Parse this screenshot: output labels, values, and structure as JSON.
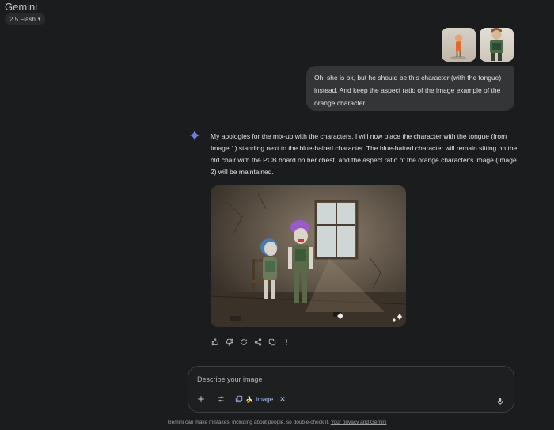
{
  "header": {
    "app_title": "Gemini",
    "model_label": "2.5 Flash"
  },
  "user_message": {
    "attachments": [
      "character-thumbnail-1",
      "character-thumbnail-2"
    ],
    "text": "Oh, she is ok, but he should be this character (with the tongue) instead. And keep the aspect ratio of the image example of the orange character"
  },
  "response": {
    "text": "My apologies for the mix-up with the characters. I will now place the character with the tongue (from Image 1) standing next to the blue-haired character. The blue-haired character will remain sitting on the old chair with the PCB board on her chest, and the aspect ratio of the orange character's image (Image 2) will be maintained.",
    "actions": [
      "thumbs-up-icon",
      "thumbs-down-icon",
      "regenerate-icon",
      "share-icon",
      "copy-icon",
      "more-icon"
    ]
  },
  "composer": {
    "placeholder": "Describe your image",
    "tool_chip_label": "Image"
  },
  "footer": {
    "disclaimer": "Gemini can make mistakes, including about people, so double-check it.",
    "privacy_link": "Your privacy and Gemini"
  },
  "colors": {
    "background": "#1b1c1d",
    "bubble": "#333537",
    "accent": "#a8c7fa"
  }
}
